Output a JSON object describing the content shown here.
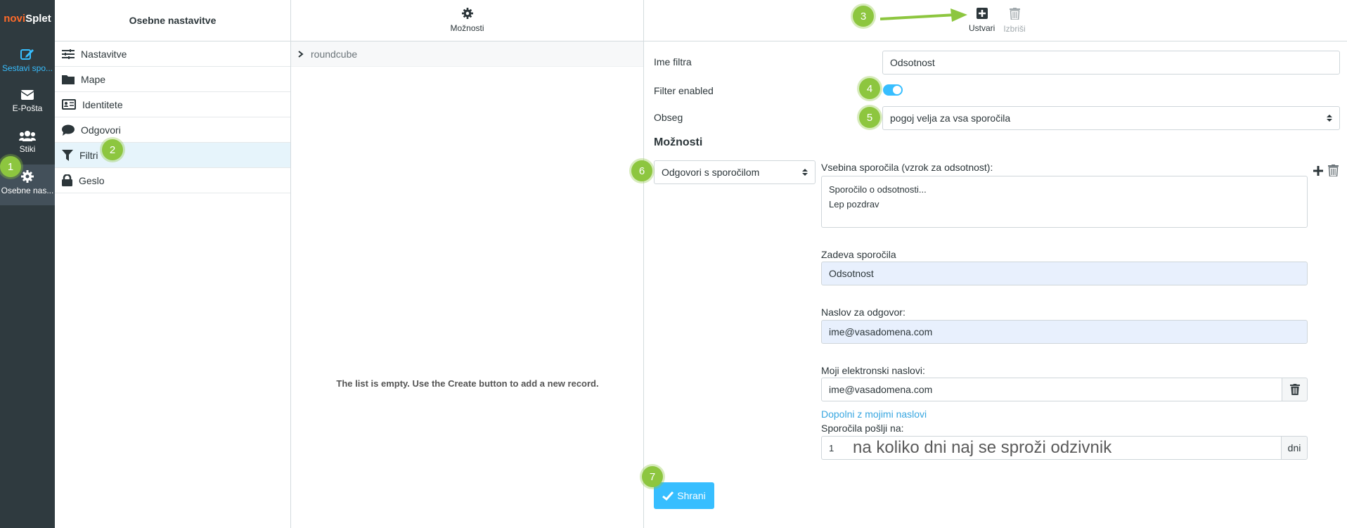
{
  "logo": {
    "part1": "novi",
    "part2": "Splet"
  },
  "nav": {
    "compose": "Sestavi spo...",
    "mail": "E-Pošta",
    "contacts": "Stiki",
    "settings": "Osebne nas..."
  },
  "settings_panel": {
    "title": "Osebne nastavitve",
    "items": [
      {
        "label": "Nastavitve",
        "icon": "sliders-icon"
      },
      {
        "label": "Mape",
        "icon": "folder-icon"
      },
      {
        "label": "Identitete",
        "icon": "id-card-icon"
      },
      {
        "label": "Odgovori",
        "icon": "comment-icon"
      },
      {
        "label": "Filtri",
        "icon": "filter-icon"
      },
      {
        "label": "Geslo",
        "icon": "lock-icon"
      }
    ]
  },
  "list_panel": {
    "options_label": "Možnosti",
    "filter_set": "roundcube",
    "empty_message": "The list is empty. Use the Create button to add a new record."
  },
  "toolbar": {
    "create": "Ustvari",
    "delete": "Izbriši"
  },
  "form": {
    "name_label": "Ime filtra",
    "name_value": "Odsotnost",
    "enabled_label": "Filter enabled",
    "scope_label": "Obseg",
    "scope_value": "pogoj velja za vsa sporočila",
    "options_heading": "Možnosti",
    "action_value": "Odgovori s sporočilom",
    "body_label": "Vsebina sporočila (vzrok za odsotnost):",
    "body_line1": "Sporočilo o odsotnosti...",
    "body_line2": "Lep pozdrav",
    "subject_label": "Zadeva sporočila",
    "subject_value": "Odsotnost",
    "reply_to_label": "Naslov za odgovor:",
    "reply_to_value": "ime@vasadomena.com",
    "my_addresses_label": "Moji elektronski naslovi:",
    "my_addresses_value": "ime@vasadomena.com",
    "fill_link": "Dopolni z mojimi naslovi",
    "days_label": "Sporočila pošlji na:",
    "days_value": "1",
    "days_unit": "dni",
    "days_annotation": "na koliko dni naj se sproži odzivnik",
    "save": "Shrani"
  },
  "badges": [
    "1",
    "2",
    "3",
    "4",
    "5",
    "6",
    "7"
  ],
  "colors": {
    "accent": "#37beff",
    "nav_bg": "#2f3a3f",
    "badge": "#8dc63f",
    "logo_accent": "#ff6a2a"
  }
}
